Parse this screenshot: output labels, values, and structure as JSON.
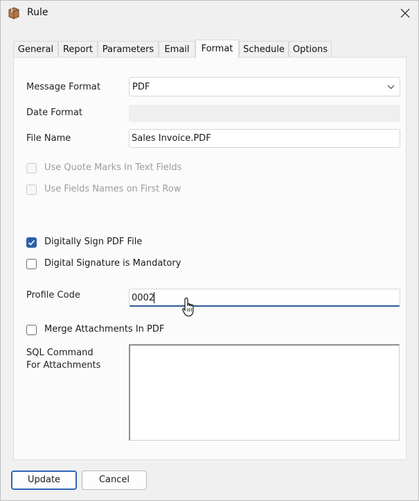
{
  "window": {
    "title": "Rule"
  },
  "tabs": [
    {
      "label": "General"
    },
    {
      "label": "Report"
    },
    {
      "label": "Parameters"
    },
    {
      "label": "Email"
    },
    {
      "label": "Format"
    },
    {
      "label": "Schedule"
    },
    {
      "label": "Options"
    }
  ],
  "active_tab": "Format",
  "form": {
    "message_format": {
      "label": "Message Format",
      "value": "PDF"
    },
    "date_format": {
      "label": "Date Format",
      "value": ""
    },
    "file_name": {
      "label": "File Name",
      "value": "Sales Invoice.PDF"
    },
    "use_quote_marks": {
      "label": "Use Quote Marks In Text Fields",
      "checked": false,
      "enabled": false
    },
    "use_field_names": {
      "label": "Use Fields Names on First Row",
      "checked": false,
      "enabled": false
    },
    "digitally_sign": {
      "label": "Digitally Sign PDF File",
      "checked": true,
      "enabled": true
    },
    "signature_mandatory": {
      "label": "Digital Signature is Mandatory",
      "checked": false,
      "enabled": true
    },
    "profile_code": {
      "label": "Profile Code",
      "value": "0002"
    },
    "merge_attachments": {
      "label": "Merge Attachments In PDF",
      "checked": false,
      "enabled": true
    },
    "sql_command": {
      "label_line1": "SQL Command",
      "label_line2": "For Attachments",
      "value": ""
    }
  },
  "buttons": {
    "update": "Update",
    "cancel": "Cancel"
  },
  "colors": {
    "accent": "#2c5fa8",
    "focus_underline": "#2e5b94"
  }
}
